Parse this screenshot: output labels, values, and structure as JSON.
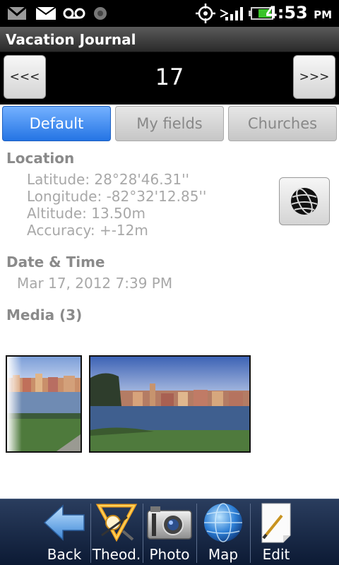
{
  "status_bar": {
    "time": "4:53",
    "ampm": "PM"
  },
  "header": {
    "title": "Vacation Journal"
  },
  "navigation": {
    "prev_label": "<<<",
    "next_label": ">>>",
    "entry_number": "17"
  },
  "tabs": [
    {
      "label": "Default",
      "active": true
    },
    {
      "label": "My fields",
      "active": false
    },
    {
      "label": "Churches",
      "active": false
    }
  ],
  "location": {
    "heading": "Location",
    "latitude": "Latitude: 28°28'46.31''",
    "longitude": "Longitude: -82°32'12.85''",
    "altitude": "Altitude: 13.50m",
    "accuracy": "Accuracy: +-12m",
    "map_button_icon": "globe-icon"
  },
  "date_time": {
    "heading": "Date & Time",
    "value": "Mar 17, 2012 7:39 PM"
  },
  "media": {
    "heading": "Media (3)"
  },
  "toolbar": {
    "items": [
      {
        "label": "Back",
        "icon": "back-arrow-icon"
      },
      {
        "label": "Theod.",
        "icon": "theodolite-icon"
      },
      {
        "label": "Photo",
        "icon": "camera-icon"
      },
      {
        "label": "Map",
        "icon": "globe-icon"
      },
      {
        "label": "Edit",
        "icon": "edit-note-icon"
      }
    ]
  },
  "colors": {
    "active_tab": "#2474e4",
    "toolbar_bg": "#0c1a34",
    "label_gray": "#8a8a8a"
  }
}
